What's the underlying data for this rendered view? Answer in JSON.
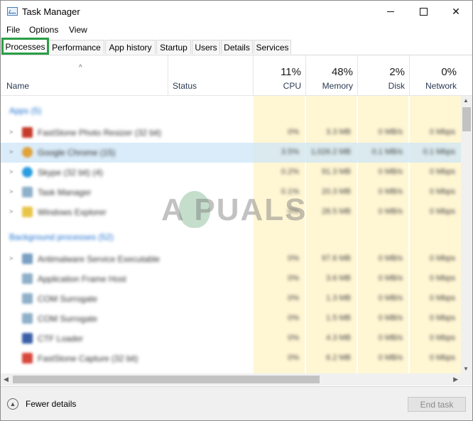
{
  "window": {
    "title": "Task Manager"
  },
  "menu": [
    "File",
    "Options",
    "View"
  ],
  "tabs": [
    "Processes",
    "Performance",
    "App history",
    "Startup",
    "Users",
    "Details",
    "Services"
  ],
  "active_tab": "Processes",
  "columns": {
    "name": "Name",
    "status": "Status",
    "cpu": {
      "pct": "11%",
      "label": "CPU"
    },
    "memory": {
      "pct": "48%",
      "label": "Memory"
    },
    "disk": {
      "pct": "2%",
      "label": "Disk"
    },
    "network": {
      "pct": "0%",
      "label": "Network"
    }
  },
  "groups": {
    "apps": "Apps (5)",
    "background": "Background processes (52)"
  },
  "processes": [
    {
      "name": "FastStone Photo Resizer (32 bit)",
      "cpu": "0%",
      "memory": "3.3 MB",
      "disk": "0 MB/s",
      "network": "0 Mbps"
    },
    {
      "name": "Google Chrome (15)",
      "cpu": "3.5%",
      "memory": "1,026.2 MB",
      "disk": "0.1 MB/s",
      "network": "0.1 Mbps"
    },
    {
      "name": "Skype (32 bit) (4)",
      "cpu": "0.2%",
      "memory": "91.3 MB",
      "disk": "0 MB/s",
      "network": "0 Mbps"
    },
    {
      "name": "Task Manager",
      "cpu": "0.1%",
      "memory": "20.3 MB",
      "disk": "0 MB/s",
      "network": "0 Mbps"
    },
    {
      "name": "Windows Explorer",
      "cpu": "0%",
      "memory": "28.5 MB",
      "disk": "0 MB/s",
      "network": "0 Mbps"
    },
    {
      "name": "Antimalware Service Executable",
      "cpu": "0%",
      "memory": "97.6 MB",
      "disk": "0 MB/s",
      "network": "0 Mbps"
    },
    {
      "name": "Application Frame Host",
      "cpu": "0%",
      "memory": "3.6 MB",
      "disk": "0 MB/s",
      "network": "0 Mbps"
    },
    {
      "name": "COM Surrogate",
      "cpu": "0%",
      "memory": "1.3 MB",
      "disk": "0 MB/s",
      "network": "0 Mbps"
    },
    {
      "name": "COM Surrogate",
      "cpu": "0%",
      "memory": "1.5 MB",
      "disk": "0 MB/s",
      "network": "0 Mbps"
    },
    {
      "name": "CTF Loader",
      "cpu": "0%",
      "memory": "4.3 MB",
      "disk": "0 MB/s",
      "network": "0 Mbps"
    },
    {
      "name": "FastStone Capture (32 bit)",
      "cpu": "0%",
      "memory": "6.2 MB",
      "disk": "0 MB/s",
      "network": "0 Mbps"
    }
  ],
  "watermark": "A PUALS",
  "footer": {
    "fewer_details": "Fewer details",
    "end_task": "End task"
  },
  "colors": {
    "accent_green": "#2a9e45",
    "heat": "#fff6d4",
    "group_blue": "#1c6fd0",
    "selection": "#cde6f7"
  }
}
